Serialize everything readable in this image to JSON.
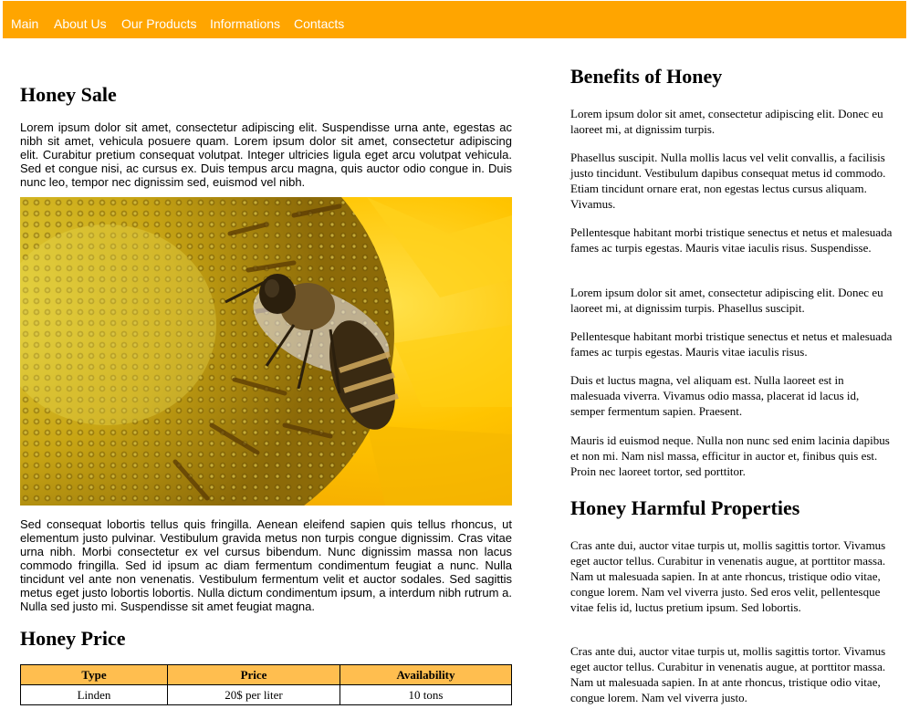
{
  "nav": {
    "items": [
      {
        "label": "Main"
      },
      {
        "label": "About Us"
      },
      {
        "label": "Our Products"
      },
      {
        "label": "Informations"
      },
      {
        "label": "Contacts"
      }
    ]
  },
  "colors": {
    "nav_bg": "#ffa500",
    "table_header_bg": "#ffbe4f"
  },
  "sale": {
    "title": "Honey Sale",
    "intro": "Lorem ipsum dolor sit amet, consectetur adipiscing elit. Suspendisse urna ante, egestas ac nibh sit amet, vehicula posuere quam. Lorem ipsum dolor sit amet, consectetur adipiscing elit. Curabitur pretium consequat volutpat. Integer ultricies ligula eget arcu volutpat vehicula. Sed et congue nisi, ac cursus ex. Duis tempus arcu magna, quis auctor odio congue in. Duis nunc leo, tempor nec dignissim sed, euismod vel nibh.",
    "image": "bee-on-sunflower-photo",
    "body": "Sed consequat lobortis tellus quis fringilla. Aenean eleifend sapien quis tellus rhoncus, ut elementum justo pulvinar. Vestibulum gravida metus non turpis congue dignissim. Cras vitae urna nibh. Morbi consectetur ex vel cursus bibendum. Nunc dignissim massa non lacus commodo fringilla. Sed id ipsum ac diam fermentum condimentum feugiat a nunc. Nulla tincidunt vel ante non venenatis. Vestibulum fermentum velit et auctor sodales. Sed sagittis metus eget justo lobortis lobortis. Nulla dictum condimentum ipsum, a interdum nibh rutrum a. Nulla sed justo mi. Suspendisse sit amet feugiat magna."
  },
  "price": {
    "title": "Honey Price",
    "headers": [
      "Type",
      "Price",
      "Availability"
    ],
    "rows": [
      [
        "Linden",
        "20$ per liter",
        "10 tons"
      ]
    ]
  },
  "benefits": {
    "title": "Benefits of Honey",
    "paragraphs": [
      "Lorem ipsum dolor sit amet, consectetur adipiscing elit. Donec eu laoreet mi, at dignissim turpis.",
      "Phasellus suscipit. Nulla mollis lacus vel velit convallis, a facilisis justo tincidunt. Vestibulum dapibus consequat metus id commodo. Etiam tincidunt ornare erat, non egestas lectus cursus aliquam. Vivamus.",
      "Pellentesque habitant morbi tristique senectus et netus et malesuada fames ac turpis egestas. Mauris vitae iaculis risus. Suspendisse.",
      "Lorem ipsum dolor sit amet, consectetur adipiscing elit. Donec eu laoreet mi, at dignissim turpis. Phasellus suscipit.",
      "Pellentesque habitant morbi tristique senectus et netus et malesuada fames ac turpis egestas. Mauris vitae iaculis risus.",
      "Duis et luctus magna, vel aliquam est. Nulla laoreet est in malesuada viverra. Vivamus odio massa, placerat id lacus id, semper fermentum sapien. Praesent.",
      "Mauris id euismod neque. Nulla non nunc sed enim lacinia dapibus et non mi. Nam nisl massa, efficitur in auctor et, finibus quis est. Proin nec laoreet tortor, sed porttitor."
    ]
  },
  "harmful": {
    "title": "Honey Harmful Properties",
    "paragraphs": [
      "Cras ante dui, auctor vitae turpis ut, mollis sagittis tortor. Vivamus eget auctor tellus. Curabitur in venenatis augue, at porttitor massa. Nam ut malesuada sapien. In at ante rhoncus, tristique odio vitae, congue lorem. Nam vel viverra justo. Sed eros velit, pellentesque vitae felis id, luctus pretium ipsum. Sed lobortis.",
      "Cras ante dui, auctor vitae turpis ut, mollis sagittis tortor. Vivamus eget auctor tellus. Curabitur in venenatis augue, at porttitor massa. Nam ut malesuada sapien. In at ante rhoncus, tristique odio vitae, congue lorem. Nam vel viverra justo."
    ]
  }
}
